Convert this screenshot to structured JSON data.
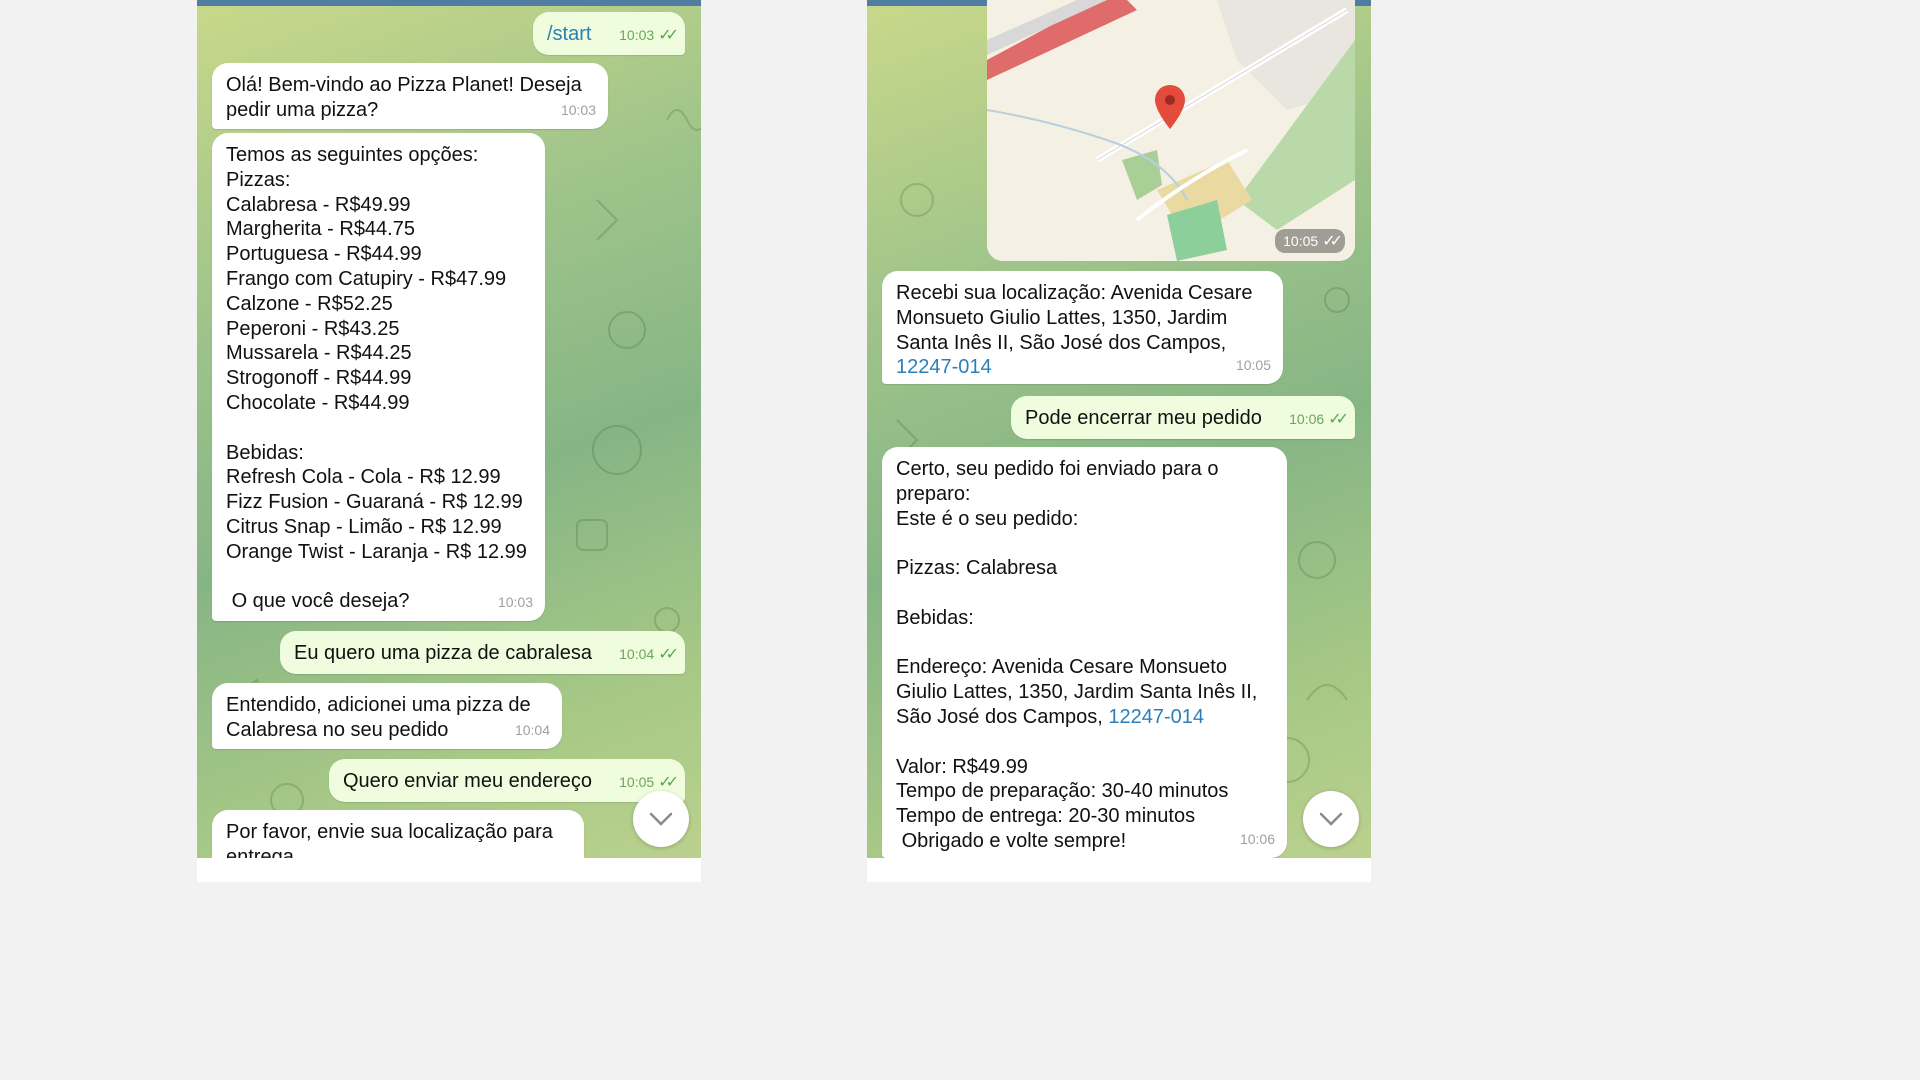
{
  "left_chat": {
    "messages": [
      {
        "dir": "out",
        "text": "/start",
        "time": "10:03"
      },
      {
        "dir": "in",
        "text": "Olá! Bem-vindo ao Pizza Planet! Deseja\npedir uma pizza?",
        "time": "10:03"
      },
      {
        "dir": "in",
        "text": "Temos as seguintes opções:\nPizzas:\nCalabresa - R$49.99\nMargherita - R$44.75\nPortuguesa - R$44.99\nFrango com Catupiry - R$47.99\nCalzone - R$52.25\nPeperoni - R$43.25\nMussarela - R$44.25\nStrogonoff - R$44.99\nChocolate - R$44.99\n\nBebidas:\nRefresh Cola - Cola - R$ 12.99\nFizz Fusion - Guaraná - R$ 12.99\nCitrus Snap - Limão - R$ 12.99\nOrange Twist - Laranja - R$ 12.99\n\n O que você deseja?",
        "time": "10:03"
      },
      {
        "dir": "out",
        "text": "Eu quero uma pizza de cabralesa",
        "time": "10:04"
      },
      {
        "dir": "in",
        "text": "Entendido, adicionei uma pizza de\nCalabresa no seu pedido",
        "time": "10:04"
      },
      {
        "dir": "out",
        "text": "Quero enviar meu endereço",
        "time": "10:05"
      },
      {
        "dir": "in",
        "text": "Por favor, envie sua localização para\nentrega",
        "time": ""
      }
    ]
  },
  "right_chat": {
    "location_time": "10:05",
    "messages": [
      {
        "dir": "in",
        "text": "Recebi sua localização: Avenida Cesare\nMonsueto Giulio Lattes, 1350, Jardim\nSanta Inês II, São José dos Campos,\n",
        "link": "12247-014",
        "time": "10:05"
      },
      {
        "dir": "out",
        "text": "Pode encerrar meu pedido",
        "time": "10:06"
      },
      {
        "dir": "in",
        "text": "Certo, seu pedido foi enviado para o\npreparo:\nEste é o seu pedido:\n\nPizzas: Calabresa\n\nBebidas:\n\nEndereço: Avenida Cesare Monsueto\nGiulio Lattes, 1350, Jardim Santa Inês II,\nSão José dos Campos, ",
        "link": "12247-014",
        "text_after": "\n\nValor: R$49.99\nTempo de preparação: 30-40 minutos\nTempo de entrega: 20-30 minutos\n Obrigado e volte sempre!",
        "time": "10:06"
      }
    ]
  },
  "icons": {
    "read_receipt": "double-check-icon",
    "scroll_down": "chevron-down-icon",
    "map_pin": "map-pin-icon"
  },
  "colors": {
    "outgoing_bubble": "#effdde",
    "incoming_bubble": "#ffffff",
    "link": "#2b7fb8",
    "header_bar": "#517da2"
  }
}
